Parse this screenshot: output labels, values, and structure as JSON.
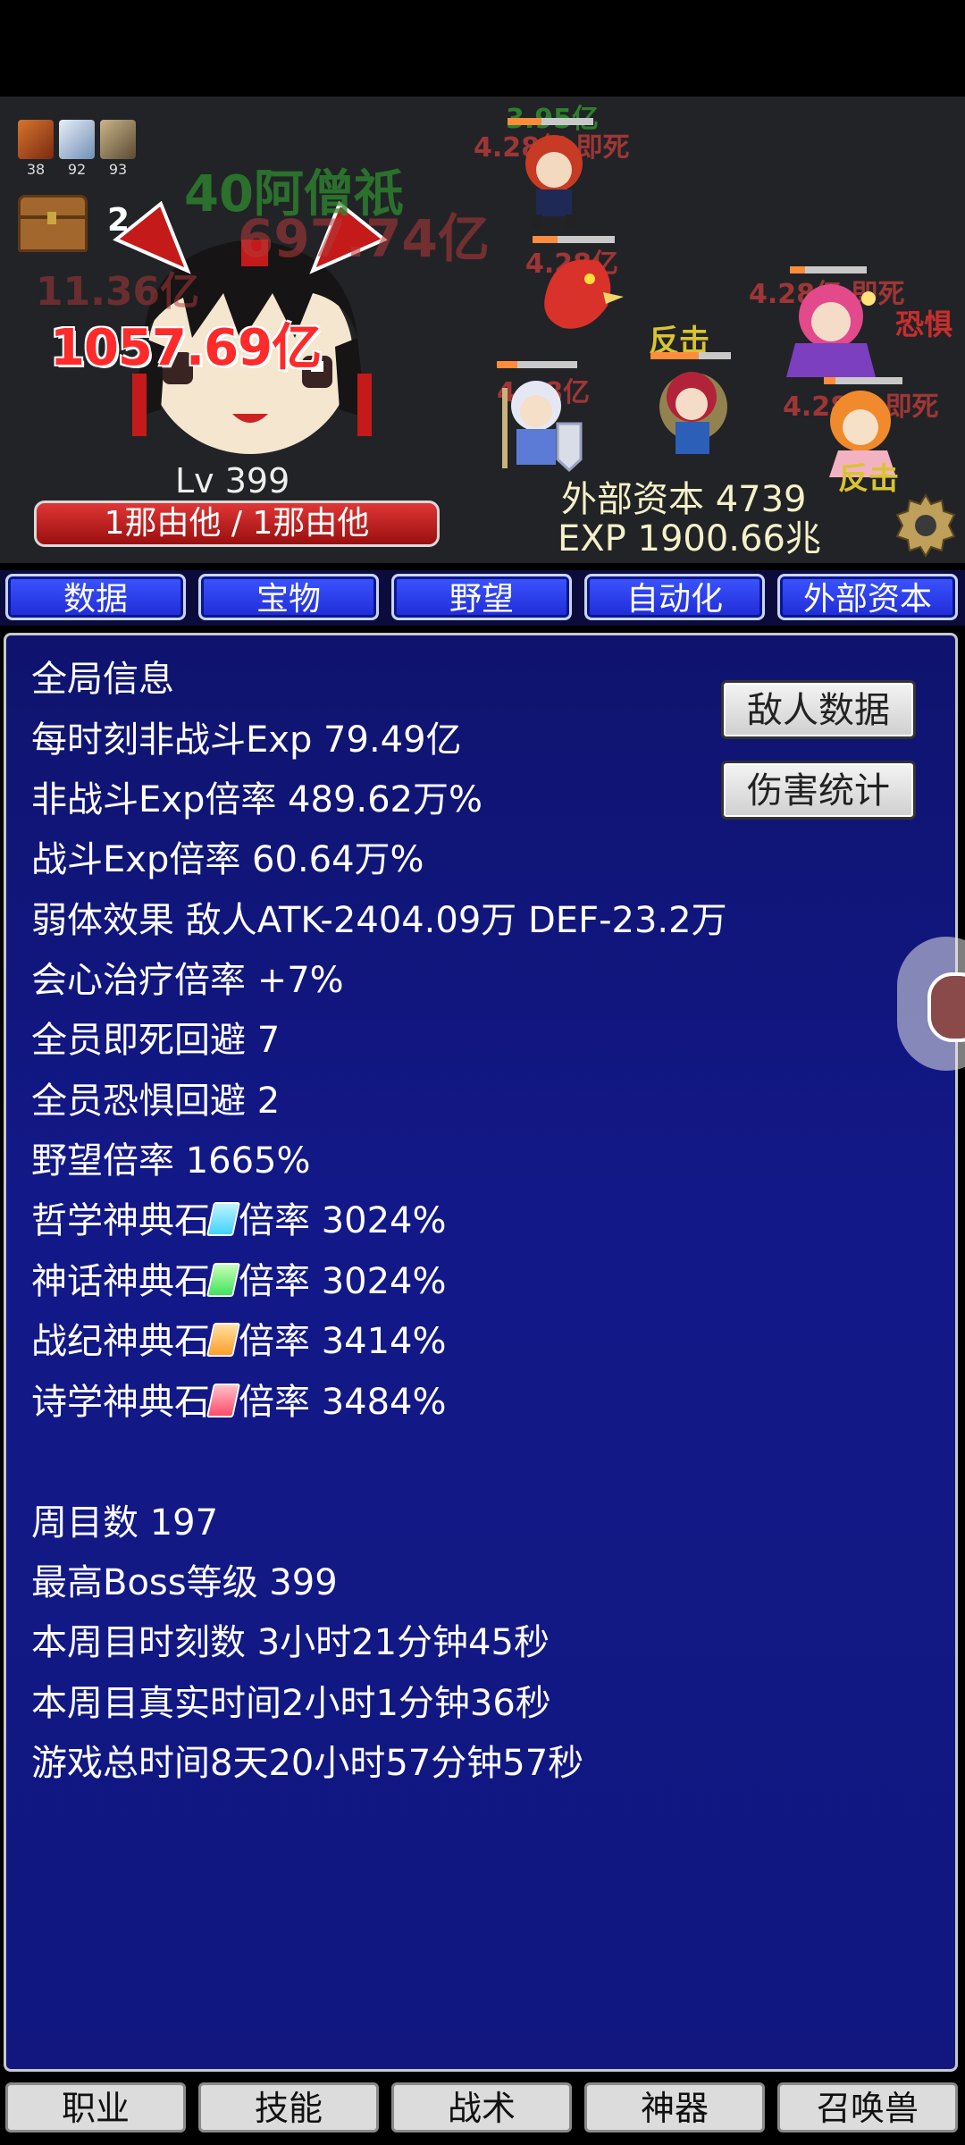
{
  "battle": {
    "enemy_icon_levels": [
      "38",
      "92",
      "93"
    ],
    "chest_count": "2",
    "gold_text": "40阿僧祇",
    "damage_numbers": {
      "top_green": "3.95亿",
      "top_red": "4.28亿 即死",
      "big_gray": "697.74亿",
      "small_gray": "11.36亿",
      "main_hit": "1057.69亿",
      "mid_red": "4.28亿",
      "right_red": "4.28亿 即死",
      "fear": "恐惧",
      "left_low_red": "4.28亿",
      "right_low_red": "4.28亿 即死",
      "counter_1": "反击",
      "counter_2": "反击"
    },
    "level_label": "Lv 399",
    "hp_label": "1那由他 / 1那由他",
    "external_capital": "外部资本 4739",
    "exp": "EXP 1900.66兆",
    "settings_icon": "gear-icon"
  },
  "top_tabs": [
    "数据",
    "宝物",
    "野望",
    "自动化",
    "外部资本"
  ],
  "panel": {
    "enemy_data_button": "敌人数据",
    "damage_stats_button": "伤害统计",
    "lines": [
      "全局信息",
      "每时刻非战斗Exp 79.49亿",
      "非战斗Exp倍率 489.62万%",
      "战斗Exp倍率 60.64万%",
      "弱体效果 敌人ATK-2404.09万 DEF-23.2万",
      "会心治疗倍率 +7%",
      "全员即死回避 7",
      "全员恐惧回避 2",
      "野望倍率 1665%"
    ],
    "stones": [
      {
        "name": "哲学神典石",
        "rate": "倍率 3024%",
        "color": "#3fd3ff"
      },
      {
        "name": "神话神典石",
        "rate": "倍率 3024%",
        "color": "#3fe35a"
      },
      {
        "name": "战纪神典石",
        "rate": "倍率 3414%",
        "color": "#ff9d2a"
      },
      {
        "name": "诗学神典石",
        "rate": "倍率 3484%",
        "color": "#ff4a6a"
      }
    ],
    "lines2": [
      "周目数 197",
      "最高Boss等级 399",
      "本周目时刻数 3小时21分钟45秒",
      "本周目真实时间2小时1分钟36秒",
      "游戏总时间8天20小时57分钟57秒"
    ]
  },
  "bottom_tabs": [
    "职业",
    "技能",
    "战术",
    "神器",
    "召唤兽"
  ]
}
